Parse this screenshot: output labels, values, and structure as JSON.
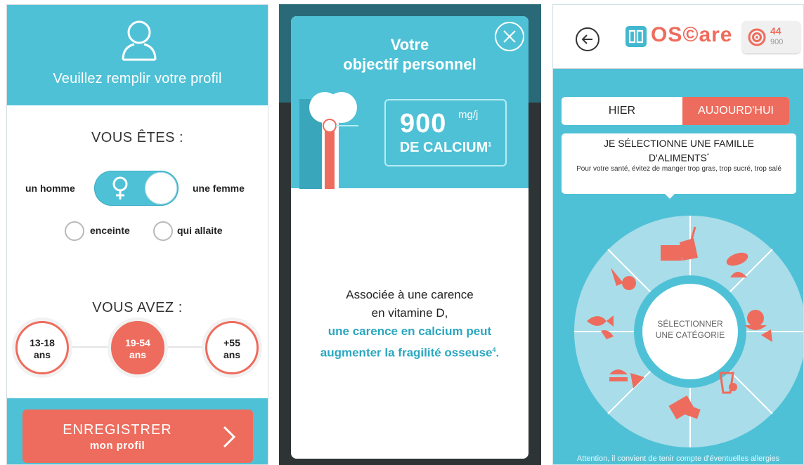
{
  "screen1": {
    "header_title": "Veuillez remplir votre profil",
    "vous_etes": "VOUS ÊTES :",
    "homme": "un homme",
    "femme": "une femme",
    "enceinte": "enceinte",
    "allaite": "qui allaite",
    "vous_avez": "VOUS AVEZ :",
    "ages": [
      {
        "l1": "13-18",
        "l2": "ans"
      },
      {
        "l1": "19-54",
        "l2": "ans"
      },
      {
        "l1": "+55",
        "l2": "ans"
      }
    ],
    "save_l1": "ENREGISTRER",
    "save_l2": "mon profil"
  },
  "screen2": {
    "title_l1": "Votre",
    "title_l2": "objectif personnel",
    "amount": "900",
    "unit": "mg/j",
    "calcium": "DE CALCIUM",
    "calcium_note": "1",
    "body_l1": "Associée à une carence",
    "body_l2": "en vitamine D,",
    "body_l3": "une carence en calcium peut",
    "body_l4": "augmenter la fragilité osseuse",
    "body_note": "4",
    "body_end": "."
  },
  "screen3": {
    "logo": "OS©are",
    "badge_value": "44",
    "badge_total": "900",
    "tab_hier": "HIER",
    "tab_today": "AUJOURD'HUI",
    "info_title_l1": "JE SÉLECTIONNE UNE FAMILLE",
    "info_title_l2": "D'ALIMENTS",
    "info_title_note": "*",
    "info_sub": "Pour votre santé, évitez de manger trop gras, trop sucré, trop salé",
    "center_l1": "SÉLECTIONNER",
    "center_l2": "UNE CATÉGORIE",
    "warning": "Attention, il convient de tenir compte d'éventuelles allergies"
  },
  "colors": {
    "teal": "#4fc1d6",
    "coral": "#ee6c5d",
    "dark": "#2e3436"
  }
}
